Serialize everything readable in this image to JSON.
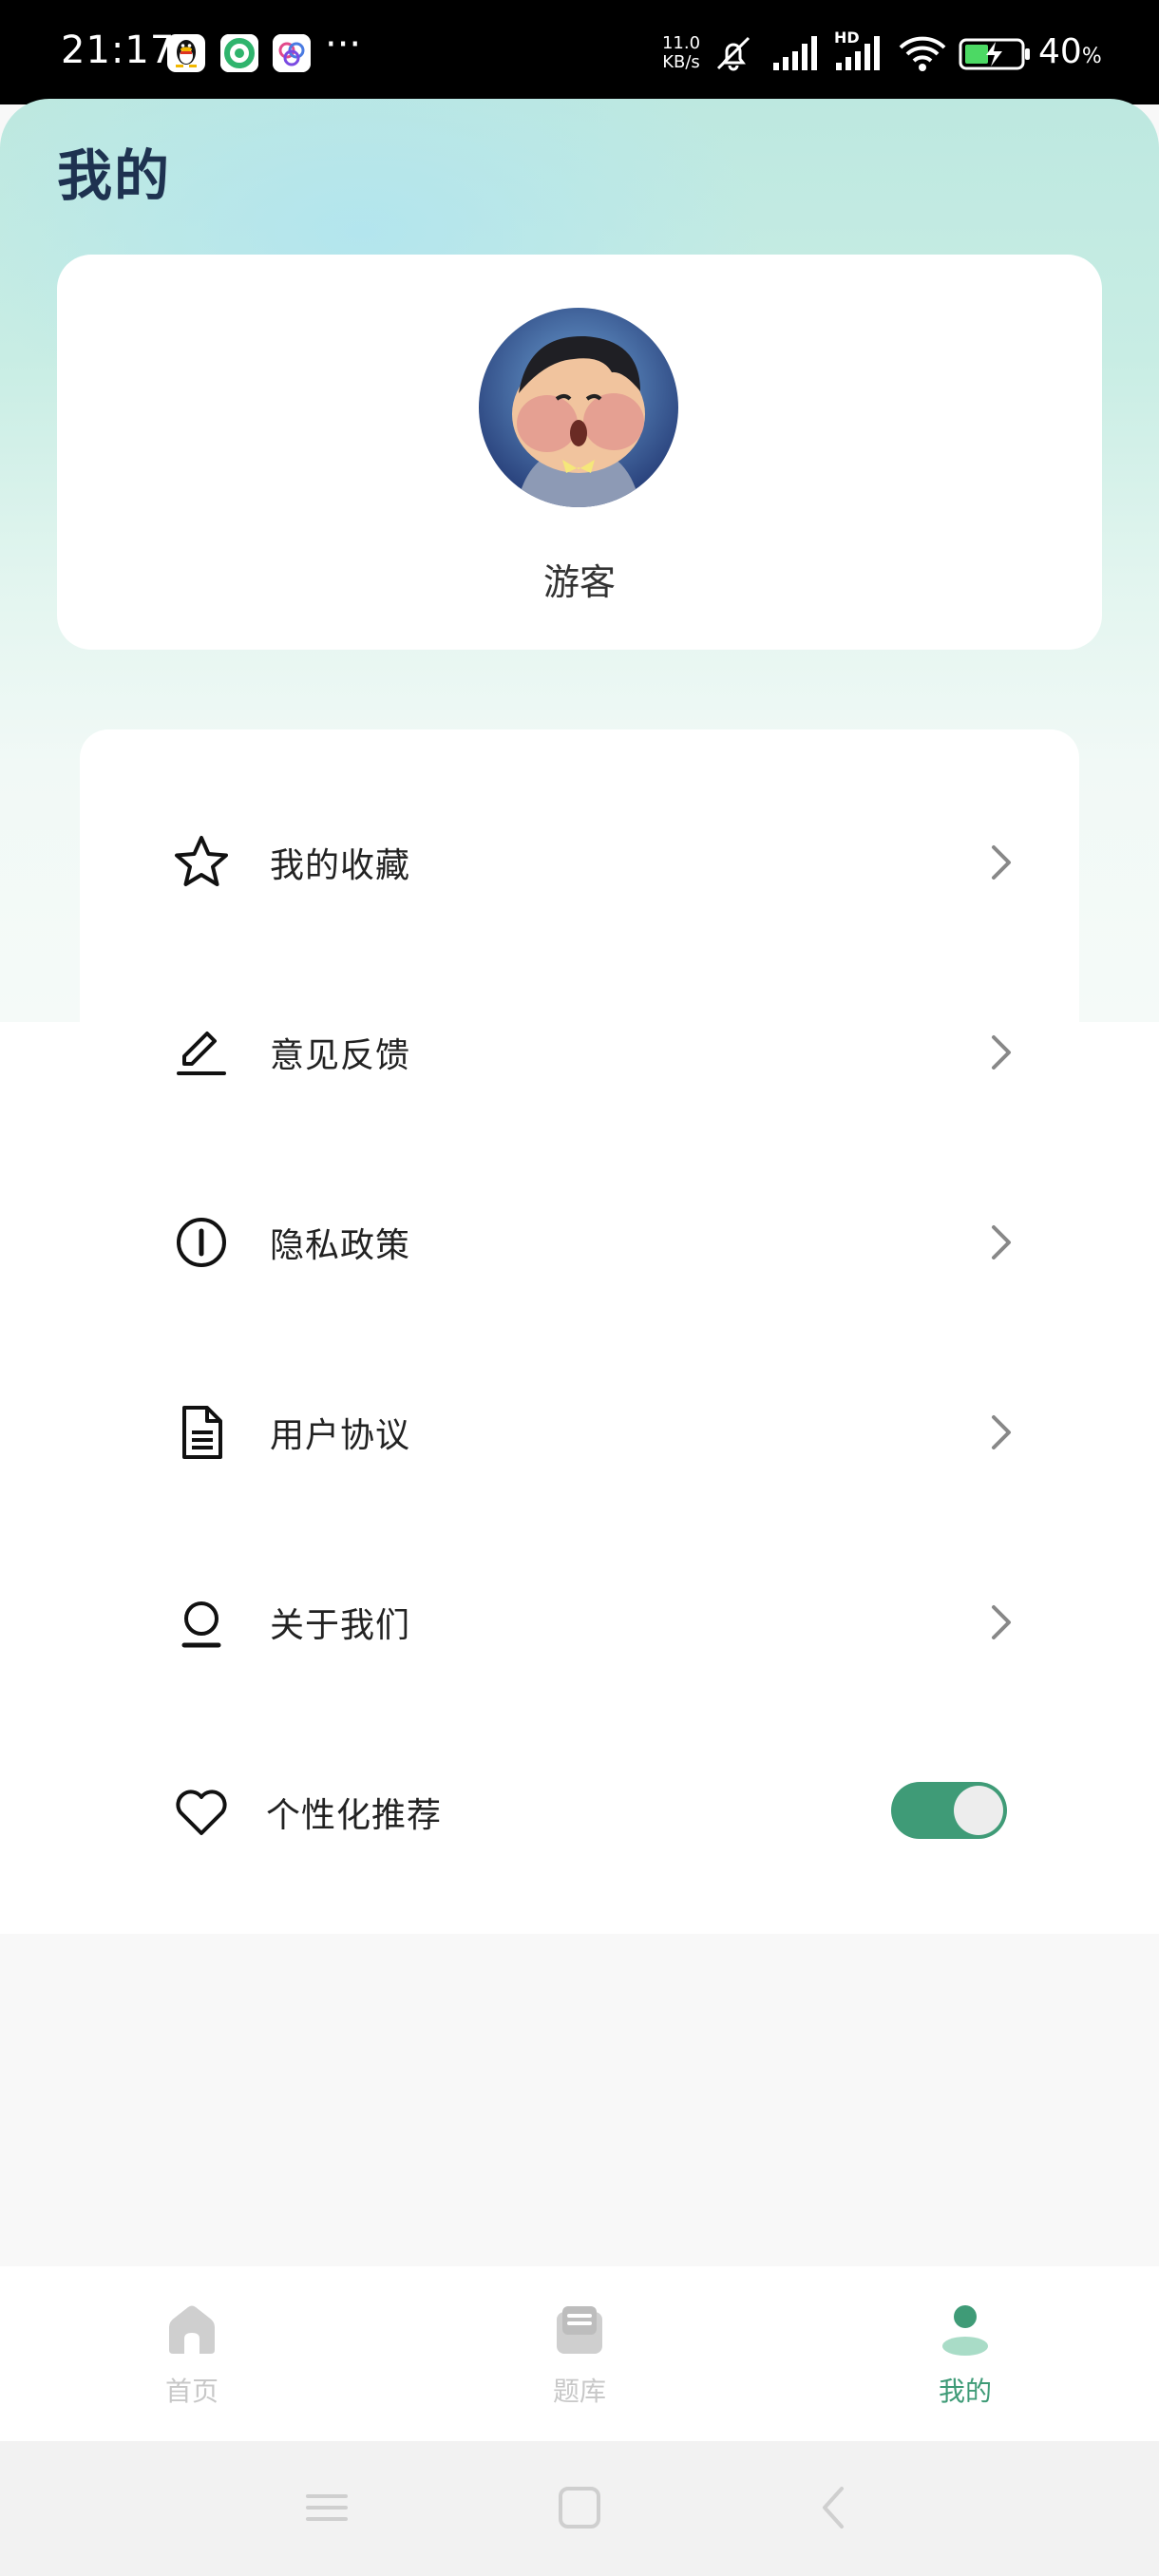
{
  "status_bar": {
    "time": "21:17",
    "more": "···",
    "net_speed_value": "11.0",
    "net_speed_unit": "KB/s",
    "network_badge": "HD",
    "battery_percent": "40",
    "battery_unit": "%",
    "notification_apps": [
      "qq-icon",
      "green-app-icon",
      "colorful-app-icon"
    ]
  },
  "header": {
    "title": "我的"
  },
  "profile": {
    "username": "游客",
    "avatar": "cartoon-boy-avatar"
  },
  "menu": {
    "items": [
      {
        "label": "我的收藏",
        "icon": "star-icon"
      },
      {
        "label": "意见反馈",
        "icon": "pen-icon"
      },
      {
        "label": "隐私政策",
        "icon": "info-circle-icon"
      },
      {
        "label": "用户协议",
        "icon": "document-icon"
      },
      {
        "label": "关于我们",
        "icon": "person-icon"
      }
    ],
    "recommend": {
      "label": "个性化推荐",
      "icon": "heart-icon",
      "enabled": true
    }
  },
  "bottom_nav": {
    "items": [
      {
        "label": "首页",
        "icon": "home-icon",
        "active": false
      },
      {
        "label": "题库",
        "icon": "question-bank-icon",
        "active": false
      },
      {
        "label": "我的",
        "icon": "profile-icon",
        "active": true
      }
    ]
  },
  "colors": {
    "accent": "#3f9b77",
    "title": "#1e3250",
    "nav_inactive": "#c8c8c8",
    "nav_active": "#3f9b77"
  }
}
